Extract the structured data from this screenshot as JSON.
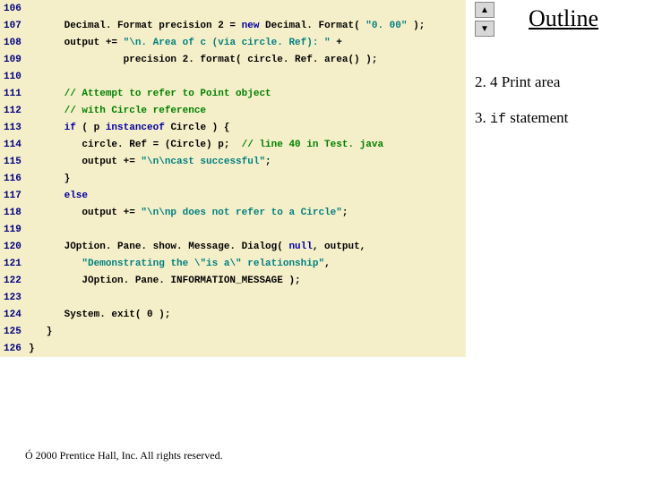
{
  "sidebar": {
    "outline": "Outline",
    "note1": "2. 4 Print area",
    "note2_pre": "3. ",
    "note2_code": "if",
    "note2_post": " statement"
  },
  "footer": {
    "copy": "Ó",
    "text": " 2000 Prentice Hall, Inc. All rights reserved."
  },
  "nav": {
    "up": "▲",
    "down": "▼"
  },
  "lines": [
    {
      "n": "106",
      "seg": []
    },
    {
      "n": "107",
      "seg": [
        {
          "t": "      Decimal. Format precision 2 = "
        },
        {
          "t": "new",
          "c": "kw"
        },
        {
          "t": " Decimal. Format( "
        },
        {
          "t": "\"0. 00\"",
          "c": "str"
        },
        {
          "t": " );"
        }
      ]
    },
    {
      "n": "108",
      "seg": [
        {
          "t": "      output += "
        },
        {
          "t": "\"\\n. Area of c (via circle. Ref): \"",
          "c": "str"
        },
        {
          "t": " +"
        }
      ]
    },
    {
      "n": "109",
      "seg": [
        {
          "t": "                precision 2. format( circle. Ref. area() );"
        }
      ]
    },
    {
      "n": "110",
      "seg": []
    },
    {
      "n": "111",
      "seg": [
        {
          "t": "      "
        },
        {
          "t": "// Attempt to refer to Point object",
          "c": "com"
        }
      ]
    },
    {
      "n": "112",
      "seg": [
        {
          "t": "      "
        },
        {
          "t": "// with Circle reference",
          "c": "com"
        }
      ]
    },
    {
      "n": "113",
      "seg": [
        {
          "t": "      "
        },
        {
          "t": "if",
          "c": "kw"
        },
        {
          "t": " ( p "
        },
        {
          "t": "instanceof",
          "c": "kw"
        },
        {
          "t": " Circle ) {"
        }
      ]
    },
    {
      "n": "114",
      "seg": [
        {
          "t": "         circle. Ref = (Circle) p;  "
        },
        {
          "t": "// line 40 in Test. java",
          "c": "com"
        }
      ]
    },
    {
      "n": "115",
      "seg": [
        {
          "t": "         output += "
        },
        {
          "t": "\"\\n\\ncast successful\"",
          "c": "str"
        },
        {
          "t": ";"
        }
      ]
    },
    {
      "n": "116",
      "seg": [
        {
          "t": "      }"
        }
      ]
    },
    {
      "n": "117",
      "seg": [
        {
          "t": "      "
        },
        {
          "t": "else",
          "c": "kw"
        }
      ]
    },
    {
      "n": "118",
      "seg": [
        {
          "t": "         output += "
        },
        {
          "t": "\"\\n\\np does not refer to a Circle\"",
          "c": "str"
        },
        {
          "t": ";"
        }
      ]
    },
    {
      "n": "119",
      "seg": []
    },
    {
      "n": "120",
      "seg": [
        {
          "t": "      JOption. Pane. show. Message. Dialog( "
        },
        {
          "t": "null",
          "c": "kw"
        },
        {
          "t": ", output,"
        }
      ]
    },
    {
      "n": "121",
      "seg": [
        {
          "t": "         "
        },
        {
          "t": "\"Demonstrating the \\\"is a\\\" relationship\"",
          "c": "str"
        },
        {
          "t": ","
        }
      ]
    },
    {
      "n": "122",
      "seg": [
        {
          "t": "         JOption. Pane. INFORMATION_MESSAGE );"
        }
      ]
    },
    {
      "n": "123",
      "seg": []
    },
    {
      "n": "124",
      "seg": [
        {
          "t": "      System. exit( 0 );"
        }
      ]
    },
    {
      "n": "125",
      "seg": [
        {
          "t": "   }"
        }
      ]
    },
    {
      "n": "126",
      "seg": [
        {
          "t": "}"
        }
      ]
    }
  ]
}
